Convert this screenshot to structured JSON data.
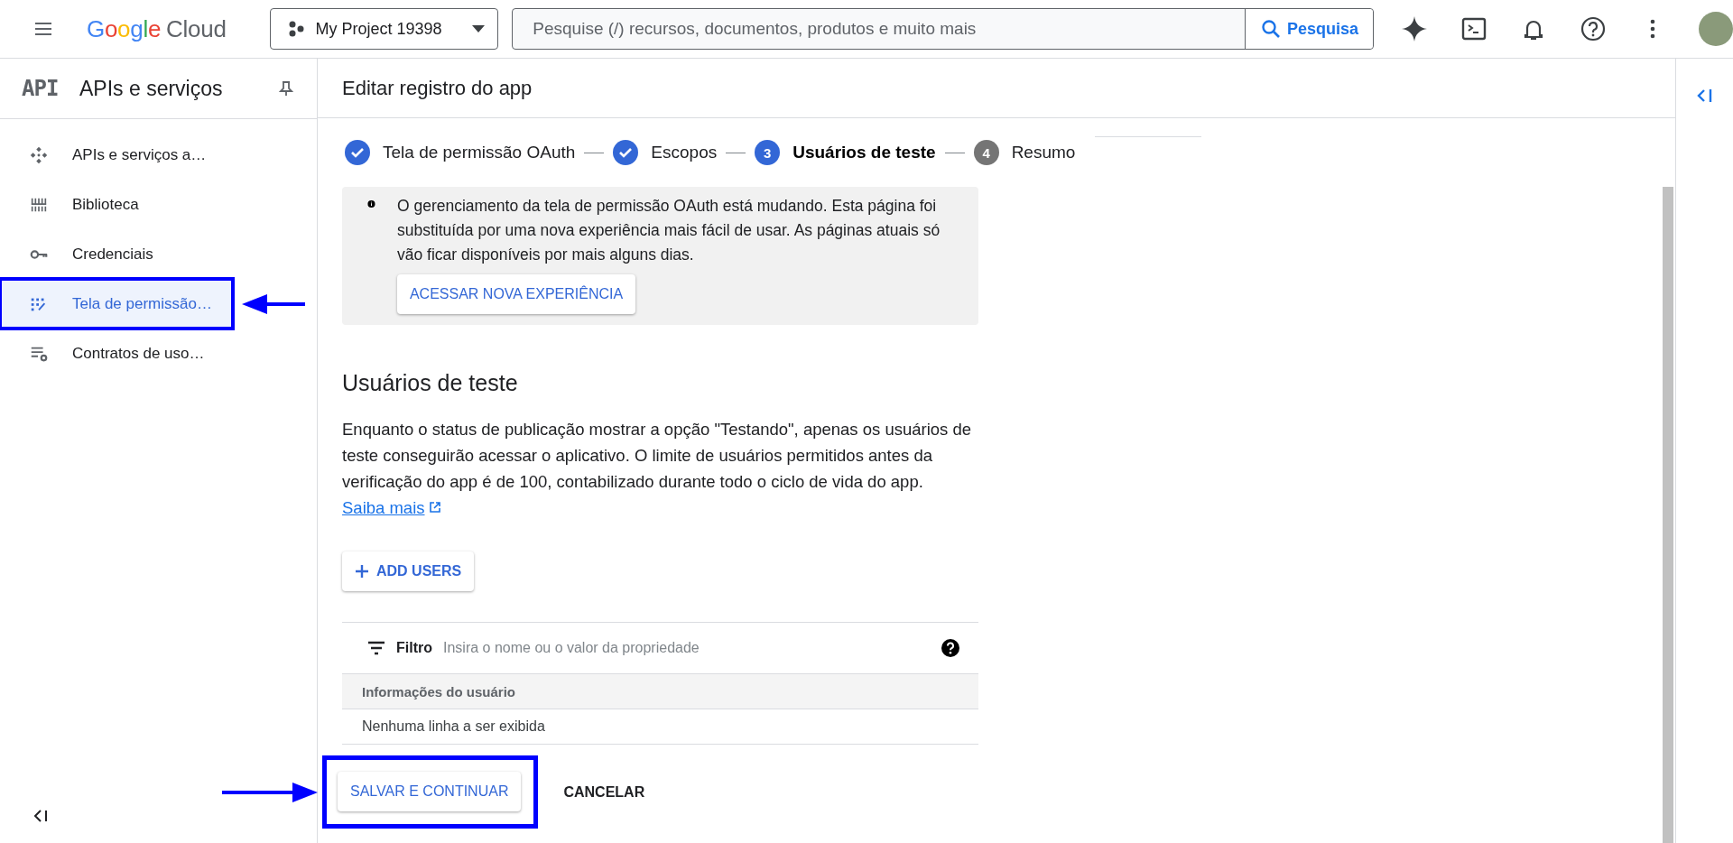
{
  "topbar": {
    "logo": {
      "brand": "Google",
      "product": "Cloud"
    },
    "project": "My Project 19398",
    "search": {
      "placeholder": "Pesquise (/) recursos, documentos, produtos e muito mais",
      "button": "Pesquisa"
    }
  },
  "sidebar": {
    "badge": "API",
    "title": "APIs e serviços",
    "items": [
      {
        "label": "APIs e serviços a…",
        "kind": "hub",
        "selected": false,
        "annotated": false
      },
      {
        "label": "Biblioteca",
        "kind": "library",
        "selected": false,
        "annotated": false
      },
      {
        "label": "Credenciais",
        "kind": "key",
        "selected": false,
        "annotated": false
      },
      {
        "label": "Tela de permissão…",
        "kind": "consent",
        "selected": true,
        "annotated": true
      },
      {
        "label": "Contratos de uso…",
        "kind": "contracts",
        "selected": false,
        "annotated": false
      }
    ]
  },
  "page_title": "Editar registro do app",
  "stepper": [
    {
      "label": "Tela de permissão OAuth",
      "completed": true,
      "selected": false
    },
    {
      "label": "Escopos",
      "completed": true,
      "selected": false
    },
    {
      "label": "Usuários de teste",
      "completed": false,
      "selected": true,
      "number": "3"
    },
    {
      "label": "Resumo",
      "completed": false,
      "selected": false,
      "number": "4"
    }
  ],
  "notice": {
    "text": "O gerenciamento da tela de permissão OAuth está mudando. Esta página foi substituída por uma nova experiência mais fácil de usar. As páginas atuais só vão ficar disponíveis por mais alguns dias.",
    "button": "ACESSAR NOVA EXPERIÊNCIA"
  },
  "section": {
    "heading": "Usuários de teste",
    "description": "Enquanto o status de publicação mostrar a opção \"Testando\", apenas os usuários de teste conseguirão acessar o aplicativo. O limite de usuários permitidos antes da verificação do app é de 100, contabilizado durante todo o ciclo de vida do app.",
    "link": "Saiba mais"
  },
  "add_users": "ADD USERS",
  "filter": {
    "label": "Filtro",
    "placeholder": "Insira o nome ou o valor da propriedade"
  },
  "table": {
    "columns": [
      "Informações do usuário"
    ],
    "empty_text": "Nenhuma linha a ser exibida"
  },
  "actions": [
    {
      "label": "SALVAR E CONTINUAR",
      "kind": "raised",
      "annotated": true
    },
    {
      "label": "CANCELAR",
      "kind": "flat",
      "annotated": false
    }
  ]
}
